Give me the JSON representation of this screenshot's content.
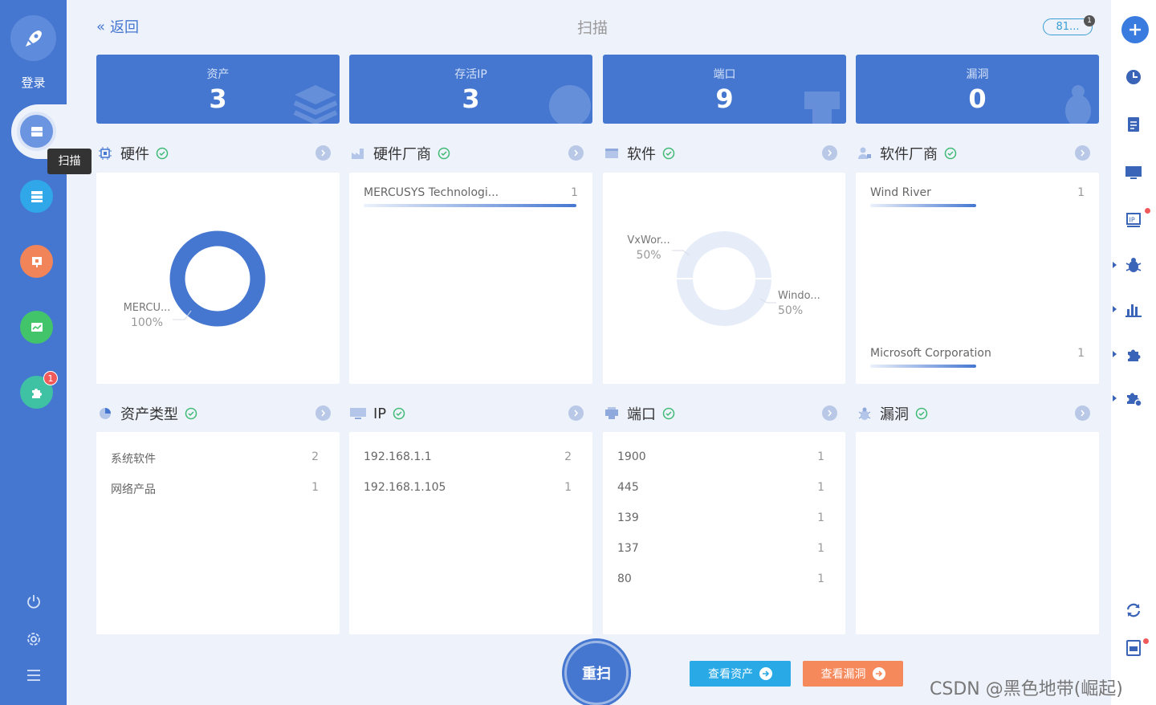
{
  "sidebar": {
    "login_label": "登录",
    "tooltip": "扫描",
    "items": [
      {
        "name": "scan",
        "icon": "scan-icon",
        "color": "#6b95e0",
        "active": true
      },
      {
        "name": "assets",
        "icon": "server-list-icon",
        "color": "#2fa7e8"
      },
      {
        "name": "report",
        "icon": "presentation-icon",
        "color": "#f2845a"
      },
      {
        "name": "monitor",
        "icon": "chart-screen-icon",
        "color": "#42c46b"
      },
      {
        "name": "plugins",
        "icon": "puzzle-icon",
        "color": "#3fc1a3",
        "badge": "1"
      }
    ],
    "bottom_icons": [
      "power-icon",
      "gear-icon",
      "menu-icon"
    ]
  },
  "header": {
    "back_label": "返回",
    "title": "扫描",
    "pill_text": "81...",
    "pill_badge": "1"
  },
  "stats": [
    {
      "label": "资产",
      "value": "3"
    },
    {
      "label": "存活IP",
      "value": "3"
    },
    {
      "label": "端口",
      "value": "9"
    },
    {
      "label": "漏洞",
      "value": "0"
    }
  ],
  "sections_top": [
    {
      "title": "硬件",
      "icon": "chip-icon"
    },
    {
      "title": "硬件厂商",
      "icon": "factory-icon"
    },
    {
      "title": "软件",
      "icon": "code-window-icon"
    },
    {
      "title": "软件厂商",
      "icon": "user-group-icon"
    }
  ],
  "sections_bottom": [
    {
      "title": "资产类型",
      "icon": "pie-icon"
    },
    {
      "title": "IP",
      "icon": "monitor-icon"
    },
    {
      "title": "端口",
      "icon": "port-icon"
    },
    {
      "title": "漏洞",
      "icon": "bug-icon"
    }
  ],
  "chart_data": [
    {
      "type": "pie",
      "title": "",
      "categories": [
        "MERCU..."
      ],
      "values": [
        100
      ],
      "labels": [
        {
          "name": "MERCU...",
          "pct": "100%"
        }
      ],
      "colors": [
        "#4577d1"
      ]
    },
    {
      "type": "pie",
      "title": "",
      "categories": [
        "VxWor...",
        "Windo..."
      ],
      "values": [
        50,
        50
      ],
      "labels": [
        {
          "name": "VxWor...",
          "pct": "50%"
        },
        {
          "name": "Windo...",
          "pct": "50%"
        }
      ],
      "colors": [
        "#e6edf9",
        "#e6edf9"
      ]
    }
  ],
  "hardware_vendors": [
    {
      "name": "MERCUSYS Technologi...",
      "count": "1"
    }
  ],
  "software_vendors": [
    {
      "name": "Wind River",
      "count": "1"
    },
    {
      "name": "Microsoft Corporation",
      "count": "1"
    }
  ],
  "asset_types": [
    {
      "name": "系统软件",
      "count": "2"
    },
    {
      "name": "网络产品",
      "count": "1"
    }
  ],
  "ips": [
    {
      "name": "192.168.1.1",
      "count": "2"
    },
    {
      "name": "192.168.1.105",
      "count": "1"
    }
  ],
  "ports": [
    {
      "name": "1900",
      "count": "1"
    },
    {
      "name": "445",
      "count": "1"
    },
    {
      "name": "139",
      "count": "1"
    },
    {
      "name": "137",
      "count": "1"
    },
    {
      "name": "80",
      "count": "1"
    }
  ],
  "actions": {
    "rescan": "重扫",
    "view_assets": "查看资产",
    "view_vulns": "查看漏洞",
    "assets_color": "#29a9e6",
    "vulns_color": "#f6895c"
  },
  "rightbar": {
    "icons": [
      "add-icon",
      "history-icon",
      "document-icon",
      "desktop-icon",
      "ip-icon",
      "bug-icon",
      "bar-chart-icon",
      "puzzle-icon",
      "puzzle-gear-icon",
      "refresh-icon",
      "log-icon"
    ]
  },
  "watermark": "CSDN @黑色地带(崛起)"
}
